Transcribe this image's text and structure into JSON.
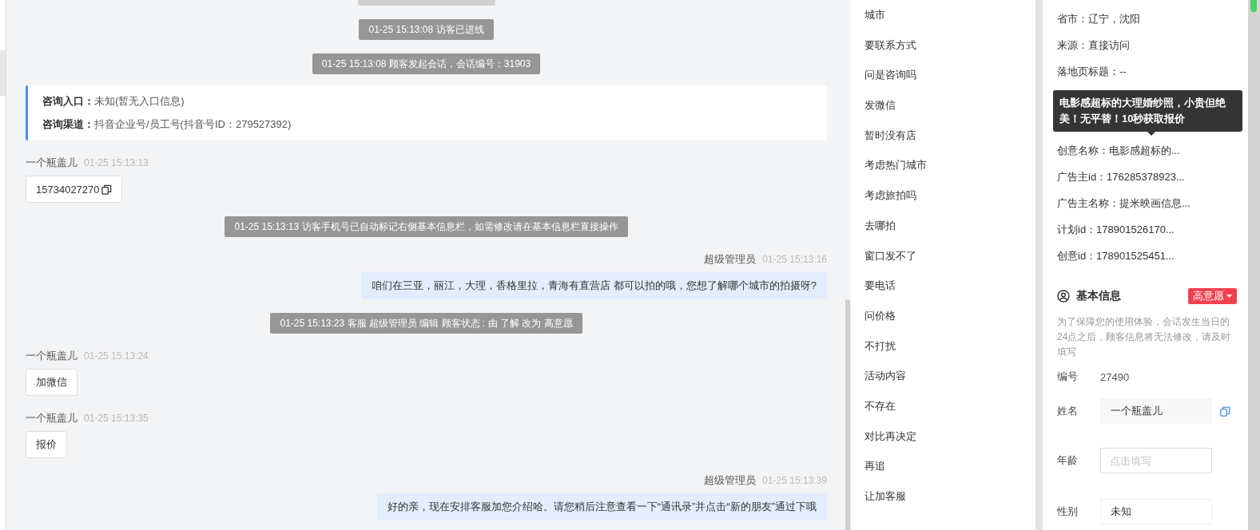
{
  "chat": {
    "messages": [
      {
        "kind": "system_edge"
      },
      {
        "kind": "system",
        "text": "01-25 15:13:08 访客已进线"
      },
      {
        "kind": "system",
        "text": "01-25 15:13:08 顾客发起会话，会话编号：31903"
      },
      {
        "kind": "info",
        "lines": [
          {
            "label": "咨询入口：",
            "value": "未知(暂无入口信息)"
          },
          {
            "label": "咨询渠道：",
            "value": "抖音企业号/员工号(抖音号ID：279527392)"
          }
        ]
      },
      {
        "kind": "visitor",
        "sender": "一个瓶盖儿",
        "time": "01-25 15:13:13",
        "text": "15734027270",
        "copyable": true
      },
      {
        "kind": "system",
        "text": "01-25 15:13:13 访客手机号已自动标记右侧基本信息栏，如需修改请在基本信息栏直接操作"
      },
      {
        "kind": "agent",
        "sender": "超级管理员",
        "time": "01-25 15:13:16",
        "text": "咱们在三亚，丽江，大理，香格里拉，青海有直营店 都可以拍的哦，您想了解哪个城市的拍摄呀?"
      },
      {
        "kind": "system",
        "text": "01-25 15:13:23 客服 超级管理员 编辑 顾客状态 : 由 了解 改为 高意愿"
      },
      {
        "kind": "visitor",
        "sender": "一个瓶盖儿",
        "time": "01-25 15:13:24",
        "text": "加微信",
        "copyable": false
      },
      {
        "kind": "visitor",
        "sender": "一个瓶盖儿",
        "time": "01-25 15:13:35",
        "text": "报价",
        "copyable": false
      },
      {
        "kind": "agent",
        "sender": "超级管理员",
        "time": "01-25 15:13:39",
        "text": "好的亲，现在安排客服加您介绍哈。请您稍后注意查看一下“通讯录”并点击“新的朋友”通过下哦"
      }
    ]
  },
  "quick_replies": [
    "城市",
    "要联系方式",
    "问是咨询吗",
    "发微信",
    "暂时没有店",
    "考虑热门城市",
    "考虑旅拍吗",
    "去哪拍",
    "窗口发不了",
    "要电话",
    "问价格",
    "不打扰",
    "活动内容",
    "不存在",
    "对比再决定",
    "再追",
    "让加客服"
  ],
  "details": {
    "fields": [
      {
        "kind": "text",
        "text": "省市：辽宁，沈阳"
      },
      {
        "kind": "text",
        "text": "来源：直接访问"
      },
      {
        "kind": "text",
        "text": "落地页标题：--"
      },
      {
        "kind": "hidden"
      },
      {
        "kind": "hidden"
      },
      {
        "kind": "text",
        "text": "创意名称：电影感超标的..."
      },
      {
        "kind": "text",
        "text": "广告主id：176285378923..."
      },
      {
        "kind": "text",
        "text": "广告主名称：提米映画信息..."
      },
      {
        "kind": "text",
        "text": "计划id：178901526170..."
      },
      {
        "kind": "text",
        "text": "创意id：178901525451..."
      }
    ],
    "tooltip": "电影感超标的大理婚纱照，小贵但绝美！无平替！10秒获取报价",
    "basic_info": {
      "title": "基本信息",
      "intent": "高意愿",
      "notice": "为了保障您的使用体验，会话发生当日的24点之后，顾客信息将无法修改，请及时填写",
      "id_label": "编号",
      "id_value": "27490",
      "form": [
        {
          "kind": "filled",
          "label": "姓名",
          "value": "一个瓶盖儿",
          "copyable": true
        },
        {
          "kind": "input",
          "label": "年龄",
          "placeholder": "点击填写"
        },
        {
          "kind": "select",
          "label": "性别",
          "value": "未知"
        }
      ]
    }
  }
}
